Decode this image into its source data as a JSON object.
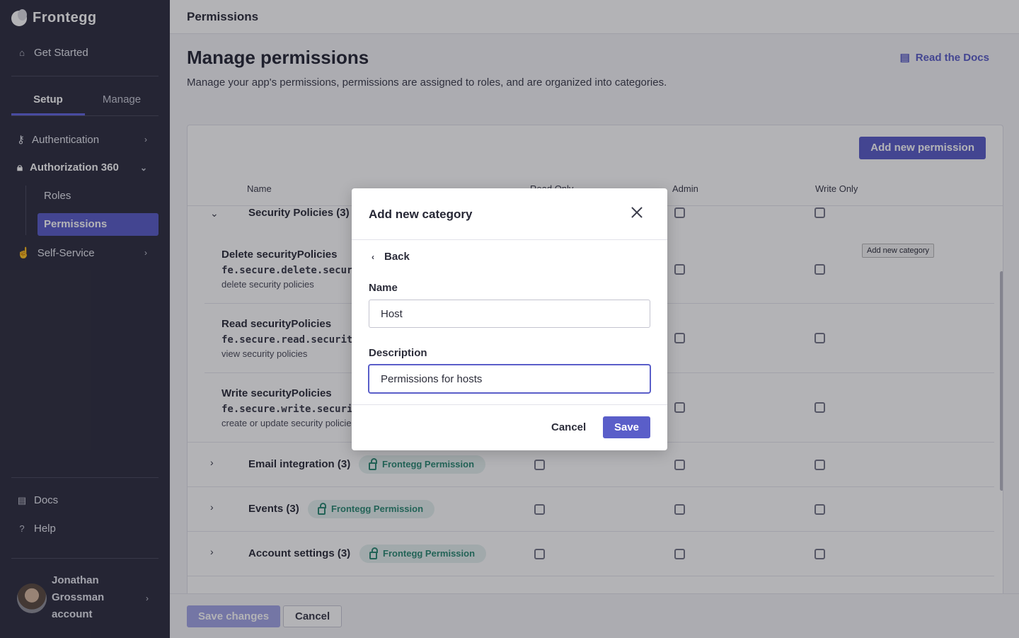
{
  "app": {
    "brand": "Frontegg"
  },
  "sidebar": {
    "get_started": "Get Started",
    "tabs": [
      "Setup",
      "Manage"
    ],
    "nav": {
      "authentication": "Authentication",
      "authorization": "Authorization 360",
      "roles": "Roles",
      "permissions": "Permissions",
      "self_service": "Self-Service"
    },
    "bottom": {
      "docs": "Docs",
      "help": "Help"
    },
    "user": {
      "name": "Jonathan Grossman account"
    }
  },
  "header": {
    "title": "Permissions"
  },
  "page": {
    "title": "Manage permissions",
    "subtitle": "Manage your app's permissions, permissions are assigned to roles, and are organized into categories.",
    "docs_link": "Read the Docs",
    "add_permission": "Add new permission"
  },
  "table": {
    "columns": {
      "name": "Name",
      "read_only": "Read Only",
      "admin": "Admin",
      "write_only": "Write Only"
    },
    "open_group": {
      "name": "Security Policies (3)"
    },
    "permissions": [
      {
        "name": "Delete securityPolicies",
        "key": "fe.secure.delete.securityPolicies",
        "desc": "delete security policies"
      },
      {
        "name": "Read securityPolicies",
        "key": "fe.secure.read.securityPolicies",
        "desc": "view security policies"
      },
      {
        "name": "Write securityPolicies",
        "key": "fe.secure.write.securityPolicies",
        "desc": "create or update security policies"
      }
    ],
    "groups": [
      {
        "name": "Email integration (3)",
        "badge": "Frontegg Permission"
      },
      {
        "name": "Events (3)",
        "badge": "Frontegg Permission"
      },
      {
        "name": "Account settings (3)",
        "badge": "Frontegg Permission"
      }
    ]
  },
  "footer": {
    "save_changes": "Save changes",
    "cancel": "Cancel"
  },
  "tooltip": "Add new category",
  "modal": {
    "title": "Add new category",
    "back": "Back",
    "name_label": "Name",
    "name_value": "Host",
    "description_label": "Description",
    "description_value": "Permissions for hosts",
    "cancel": "Cancel",
    "save": "Save"
  },
  "colors": {
    "accent": "#5a5ec9",
    "sidebar": "#2e2f40",
    "badge_text": "#2b8a74"
  }
}
